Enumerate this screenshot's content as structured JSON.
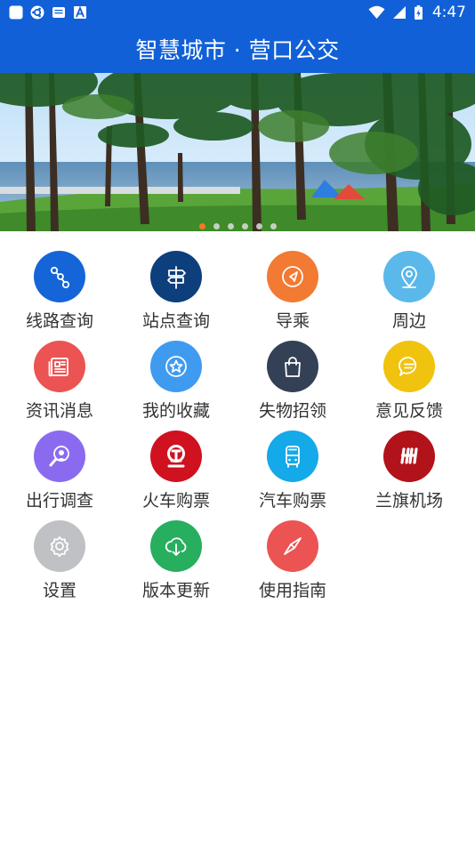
{
  "status_bar": {
    "time": "4:47",
    "left_icons": [
      "app-square-icon",
      "ubuntu-style-icon",
      "message-icon",
      "a-icon"
    ],
    "right_icons": [
      "wifi-icon",
      "signal-icon",
      "battery-charging-icon"
    ]
  },
  "app_bar": {
    "title": "智慧城市 · 营口公交"
  },
  "banner": {
    "slide_count": 6,
    "active_slide": 1,
    "active_color": "#f47a1f"
  },
  "menu": {
    "items": [
      {
        "label": "线路查询",
        "icon": "route-icon",
        "color": "#1565d8"
      },
      {
        "label": "站点查询",
        "icon": "signpost-icon",
        "color": "#0d3f7d"
      },
      {
        "label": "导乘",
        "icon": "compass-arrow-icon",
        "color": "#f27a32"
      },
      {
        "label": "周边",
        "icon": "location-pin-icon",
        "color": "#5ab8ea"
      },
      {
        "label": "资讯消息",
        "icon": "newspaper-icon",
        "color": "#ec5353"
      },
      {
        "label": "我的收藏",
        "icon": "star-icon",
        "color": "#3f9bf0"
      },
      {
        "label": "失物招领",
        "icon": "shopping-bag-icon",
        "color": "#344056"
      },
      {
        "label": "意见反馈",
        "icon": "chat-bubble-icon",
        "color": "#f0c30f"
      },
      {
        "label": "出行调查",
        "icon": "survey-person-icon",
        "color": "#8a6bf0"
      },
      {
        "label": "火车购票",
        "icon": "railway-logo-icon",
        "color": "#cf1120"
      },
      {
        "label": "汽车购票",
        "icon": "bus-icon",
        "color": "#14a9e8"
      },
      {
        "label": "兰旗机场",
        "icon": "airport-logo-icon",
        "color": "#b21219"
      },
      {
        "label": "设置",
        "icon": "gear-icon",
        "color": "#bfc1c4"
      },
      {
        "label": "版本更新",
        "icon": "cloud-download-icon",
        "color": "#27ae5f"
      },
      {
        "label": "使用指南",
        "icon": "compass-needle-icon",
        "color": "#ec5353"
      }
    ]
  }
}
